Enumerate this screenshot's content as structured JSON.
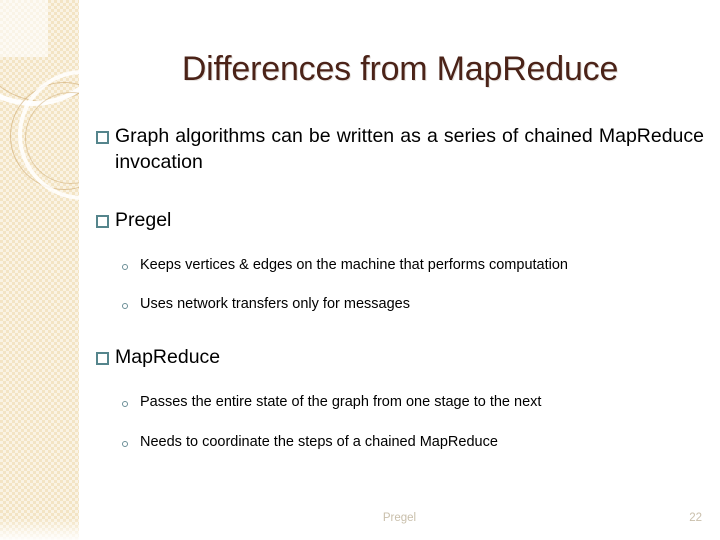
{
  "slide": {
    "title": "Differences from MapReduce",
    "title_color": "#4b2318",
    "background_color": "#ffffff",
    "sidebar": {
      "name": "decorative-sidebar",
      "base_color": "#f3e4c4",
      "accent_ring_color": "#cdaa70"
    },
    "bullet_colors": {
      "level1_marker": "#55858c",
      "level2_marker": "#6b8e96"
    },
    "body": [
      {
        "level": 1,
        "marker": "hollow-square",
        "text": "Graph algorithms can be written as a series of chained MapReduce invocation"
      },
      {
        "level": 1,
        "marker": "hollow-square",
        "text": "Pregel"
      },
      {
        "level": 2,
        "marker": "hollow-circle",
        "text": "Keeps vertices & edges on the machine that performs computation"
      },
      {
        "level": 2,
        "marker": "hollow-circle",
        "text": "Uses network transfers only for messages"
      },
      {
        "level": 1,
        "marker": "hollow-square",
        "text": "MapReduce"
      },
      {
        "level": 2,
        "marker": "hollow-circle",
        "text": "Passes the entire state of the graph from one stage to the next"
      },
      {
        "level": 2,
        "marker": "hollow-circle",
        "text": "Needs to coordinate the steps of a chained MapReduce"
      }
    ],
    "footer": {
      "center_label": "Pregel",
      "slide_number": "22",
      "text_color": "#c9bfab"
    }
  }
}
